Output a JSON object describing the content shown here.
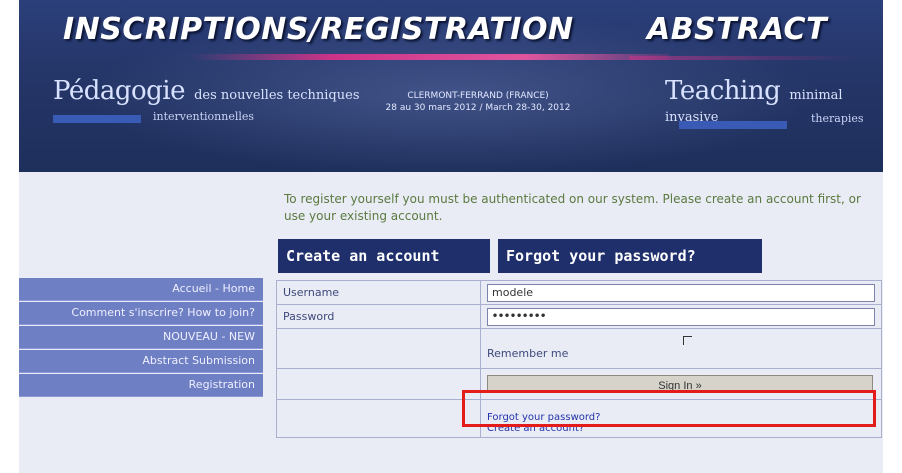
{
  "banner": {
    "title_left": "INSCRIPTIONS/REGISTRATION",
    "title_right": "ABSTRACT",
    "logo_left_big": "Pédagogie",
    "logo_left_small": "des nouvelles techniques",
    "logo_left_sub": "interventionnelles",
    "event_line1": "CLERMONT-FERRAND (FRANCE)",
    "event_line2": "28 au 30 mars 2012 / March 28-30, 2012",
    "logo_right_big": "Teaching",
    "logo_right_small": "minimal invasive",
    "logo_right_sub": "therapies"
  },
  "menu": {
    "items": [
      {
        "label": "Accueil - Home"
      },
      {
        "label": "Comment s'inscrire? How to join?"
      },
      {
        "label": "NOUVEAU - NEW"
      },
      {
        "label": "Abstract Submission"
      },
      {
        "label": "Registration"
      }
    ]
  },
  "main": {
    "intro": "To register yourself you must be authenticated on our system. Please create an account first, or use your existing account.",
    "tab_create": "Create an account",
    "tab_forgot": "Forgot your password?"
  },
  "form": {
    "username_label": "Username",
    "username_value": "modele",
    "password_label": "Password",
    "password_value": "•••••••••",
    "remember_label": "Remember me",
    "signin_label": "Sign In »",
    "forgot_link": "Forgot your password?",
    "create_link": "Create an account?"
  },
  "colors": {
    "banner": "#243567",
    "menu": "#6f7fc4",
    "tab": "#1f2f6b",
    "highlight": "#e41b1b"
  }
}
